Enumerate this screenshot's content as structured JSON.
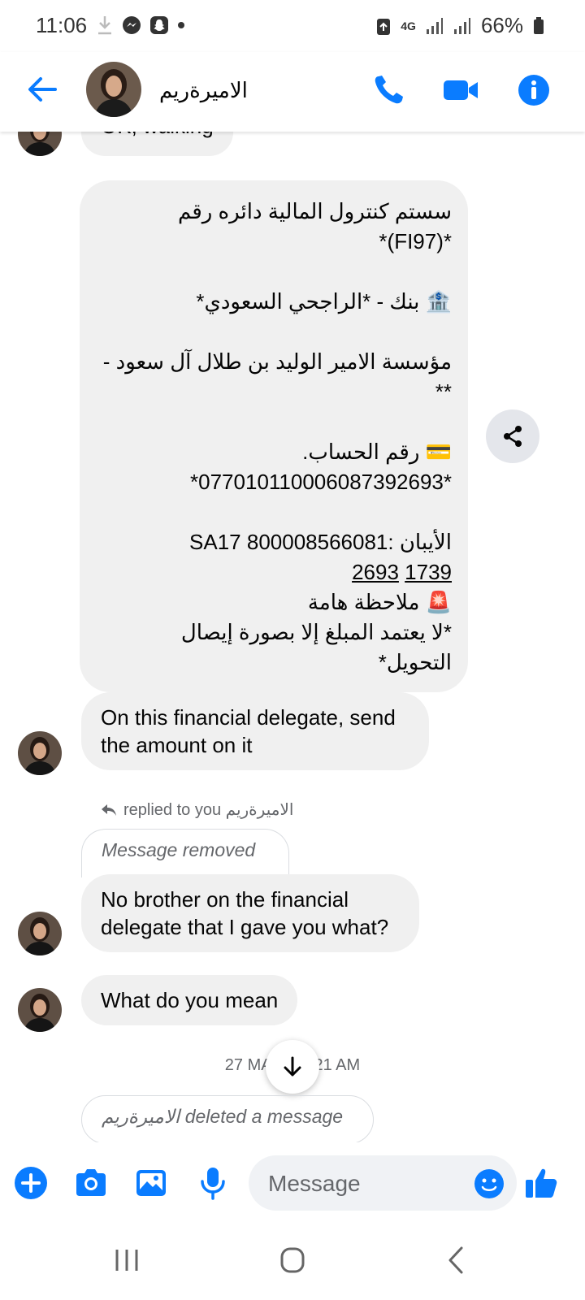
{
  "status_bar": {
    "time": "11:06",
    "network": "4G",
    "battery": "66%"
  },
  "header": {
    "contact_name": "الاميرةريم"
  },
  "messages": {
    "partial_top": "OK, walking",
    "arabic_block": {
      "l1": "سستم كنترول المالية دائره رقم",
      "l2": "*(FI97)*",
      "l3": "🏦 بنك - *الراجحي السعودي*",
      "l4": "مؤسسة الامير الوليد بن طلال آل سعود -",
      "l5": "**",
      "l6": "💳 رقم الحساب.",
      "l7": "*077010110006087392693*",
      "l8": "الأيبان :SA17 800008566081",
      "l9a": "2693",
      "l9b": "1739",
      "l10": "🚨 ملاحظة هامة",
      "l11": "*لا يعتمد المبلغ إلا بصورة إيصال",
      "l12": "التحويل*"
    },
    "m1": "On this financial delegate, send the amount on it",
    "reply_note": "replied to you الاميرةريم",
    "removed": "Message removed",
    "m2": "No brother on the financial delegate that I gave you what?",
    "m3": "What do you mean",
    "date_separator": "27 MAR, 11:21 AM",
    "deleted": "الاميرةريم deleted a message"
  },
  "composer": {
    "placeholder": "Message"
  },
  "colors": {
    "accent": "#0a7cff",
    "bubble": "#f0f0f0",
    "muted": "#65676b"
  },
  "icons": [
    "back-arrow-icon",
    "phone-icon",
    "video-icon",
    "info-icon",
    "share-icon",
    "reply-icon",
    "arrow-down-icon",
    "plus-icon",
    "camera-icon",
    "image-icon",
    "mic-icon",
    "emoji-icon",
    "thumbs-up-icon",
    "recents-icon",
    "home-icon",
    "back-nav-icon"
  ]
}
